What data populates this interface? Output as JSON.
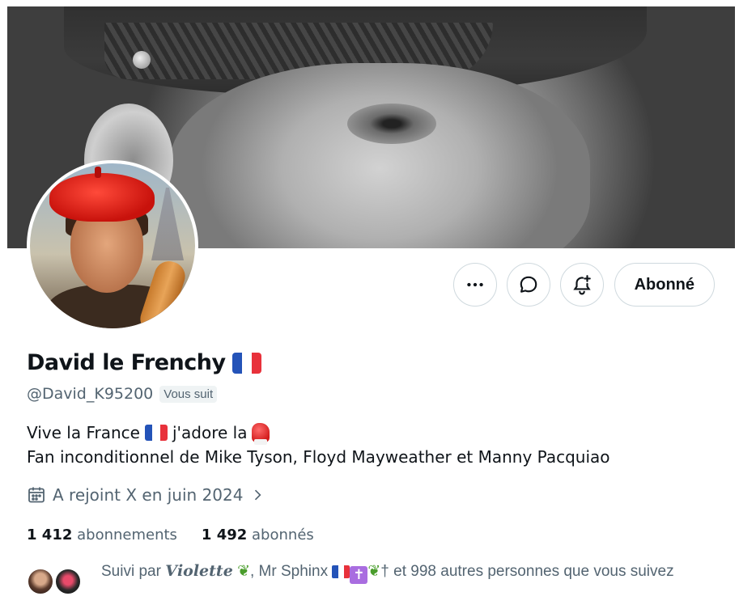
{
  "profile": {
    "display_name": "David le Frenchy",
    "handle": "@David_K95200",
    "follows_you_badge": "Vous suit",
    "bio_line1_a": "Vive la France",
    "bio_line1_b": "j'adore la",
    "bio_line2": "Fan inconditionnel de Mike Tyson, Floyd Mayweather et Manny Pacquiao",
    "joined": "A rejoint X en juin 2024"
  },
  "actions": {
    "more_icon": "more-horizontal-icon",
    "message_icon": "message-icon",
    "notify_icon": "bell-plus-icon",
    "follow_label": "Abonné"
  },
  "stats": {
    "following_count": "1 412",
    "following_label": "abonnements",
    "followers_count": "1 492",
    "followers_label": "abonnés"
  },
  "followed_by": {
    "prefix": "Suivi par",
    "user1": "𝑽𝒊𝒐𝒍𝒆𝒕𝒕𝒆",
    "sep": ", Mr Sphinx",
    "dagger": "†",
    "suffix": "et 998 autres personnes que vous suivez"
  },
  "colors": {
    "text_primary": "#0f1419",
    "text_secondary": "#536471",
    "border": "#cfd9de"
  }
}
